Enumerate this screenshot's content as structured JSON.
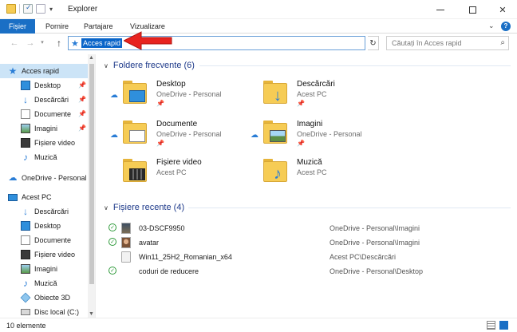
{
  "window": {
    "title": "Explorer",
    "minimize_glyph": "",
    "close_glyph": "✕"
  },
  "ribbon": {
    "tabs": [
      "Fișier",
      "Pornire",
      "Partajare",
      "Vizualizare"
    ],
    "collapse_glyph": "⌄",
    "help_glyph": "?"
  },
  "nav": {
    "back_glyph": "←",
    "forward_glyph": "→",
    "recent_glyph": "▾",
    "up_glyph": "↑",
    "address_value": "Acces rapid",
    "refresh_glyph": "↻",
    "search_placeholder": "Căutați în Acces rapid",
    "search_glyph": "⌕"
  },
  "annotation": {
    "arrow_color": "#e8231f"
  },
  "sidebar": {
    "quick_access": "Acces rapid",
    "pinned": [
      {
        "label": "Desktop",
        "icon": "desktop-icon",
        "pinned": true
      },
      {
        "label": "Descărcări",
        "icon": "downloads-icon",
        "pinned": true
      },
      {
        "label": "Documente",
        "icon": "documents-icon",
        "pinned": true
      },
      {
        "label": "Imagini",
        "icon": "pictures-icon",
        "pinned": true
      },
      {
        "label": "Fișiere video",
        "icon": "videos-icon",
        "pinned": false
      },
      {
        "label": "Muzică",
        "icon": "music-icon",
        "pinned": false
      }
    ],
    "onedrive": "OneDrive - Personal",
    "this_pc": "Acest PC",
    "pc_items": [
      {
        "label": "Descărcări",
        "icon": "downloads-icon"
      },
      {
        "label": "Desktop",
        "icon": "desktop-icon"
      },
      {
        "label": "Documente",
        "icon": "documents-icon"
      },
      {
        "label": "Fișiere video",
        "icon": "videos-icon"
      },
      {
        "label": "Imagini",
        "icon": "pictures-icon"
      },
      {
        "label": "Muzică",
        "icon": "music-icon"
      },
      {
        "label": "Obiecte 3D",
        "icon": "3d-objects-icon"
      },
      {
        "label": "Disc local (C:)",
        "icon": "disk-icon"
      }
    ]
  },
  "main": {
    "frequent_header": "Foldere frecvente (6)",
    "frequent": [
      {
        "name": "Desktop",
        "location": "OneDrive - Personal",
        "cloud": true,
        "pinned": true
      },
      {
        "name": "Descărcări",
        "location": "Acest PC",
        "cloud": false,
        "pinned": true
      },
      {
        "name": "Documente",
        "location": "OneDrive - Personal",
        "cloud": true,
        "pinned": true
      },
      {
        "name": "Imagini",
        "location": "OneDrive - Personal",
        "cloud": true,
        "pinned": true
      },
      {
        "name": "Fișiere video",
        "location": "Acest PC",
        "cloud": false,
        "pinned": false
      },
      {
        "name": "Muzică",
        "location": "Acest PC",
        "cloud": false,
        "pinned": false
      }
    ],
    "recent_header": "Fișiere recente (4)",
    "recent": [
      {
        "name": "03-DSCF9950",
        "path": "OneDrive - Personal\\Imagini",
        "synced": true
      },
      {
        "name": "avatar",
        "path": "OneDrive - Personal\\Imagini",
        "synced": true
      },
      {
        "name": "Win11_25H2_Romanian_x64",
        "path": "Acest PC\\Descărcări",
        "synced": false
      },
      {
        "name": "coduri de reducere",
        "path": "OneDrive - Personal\\Desktop",
        "synced": true
      }
    ]
  },
  "status": {
    "item_count": "10 elemente"
  }
}
